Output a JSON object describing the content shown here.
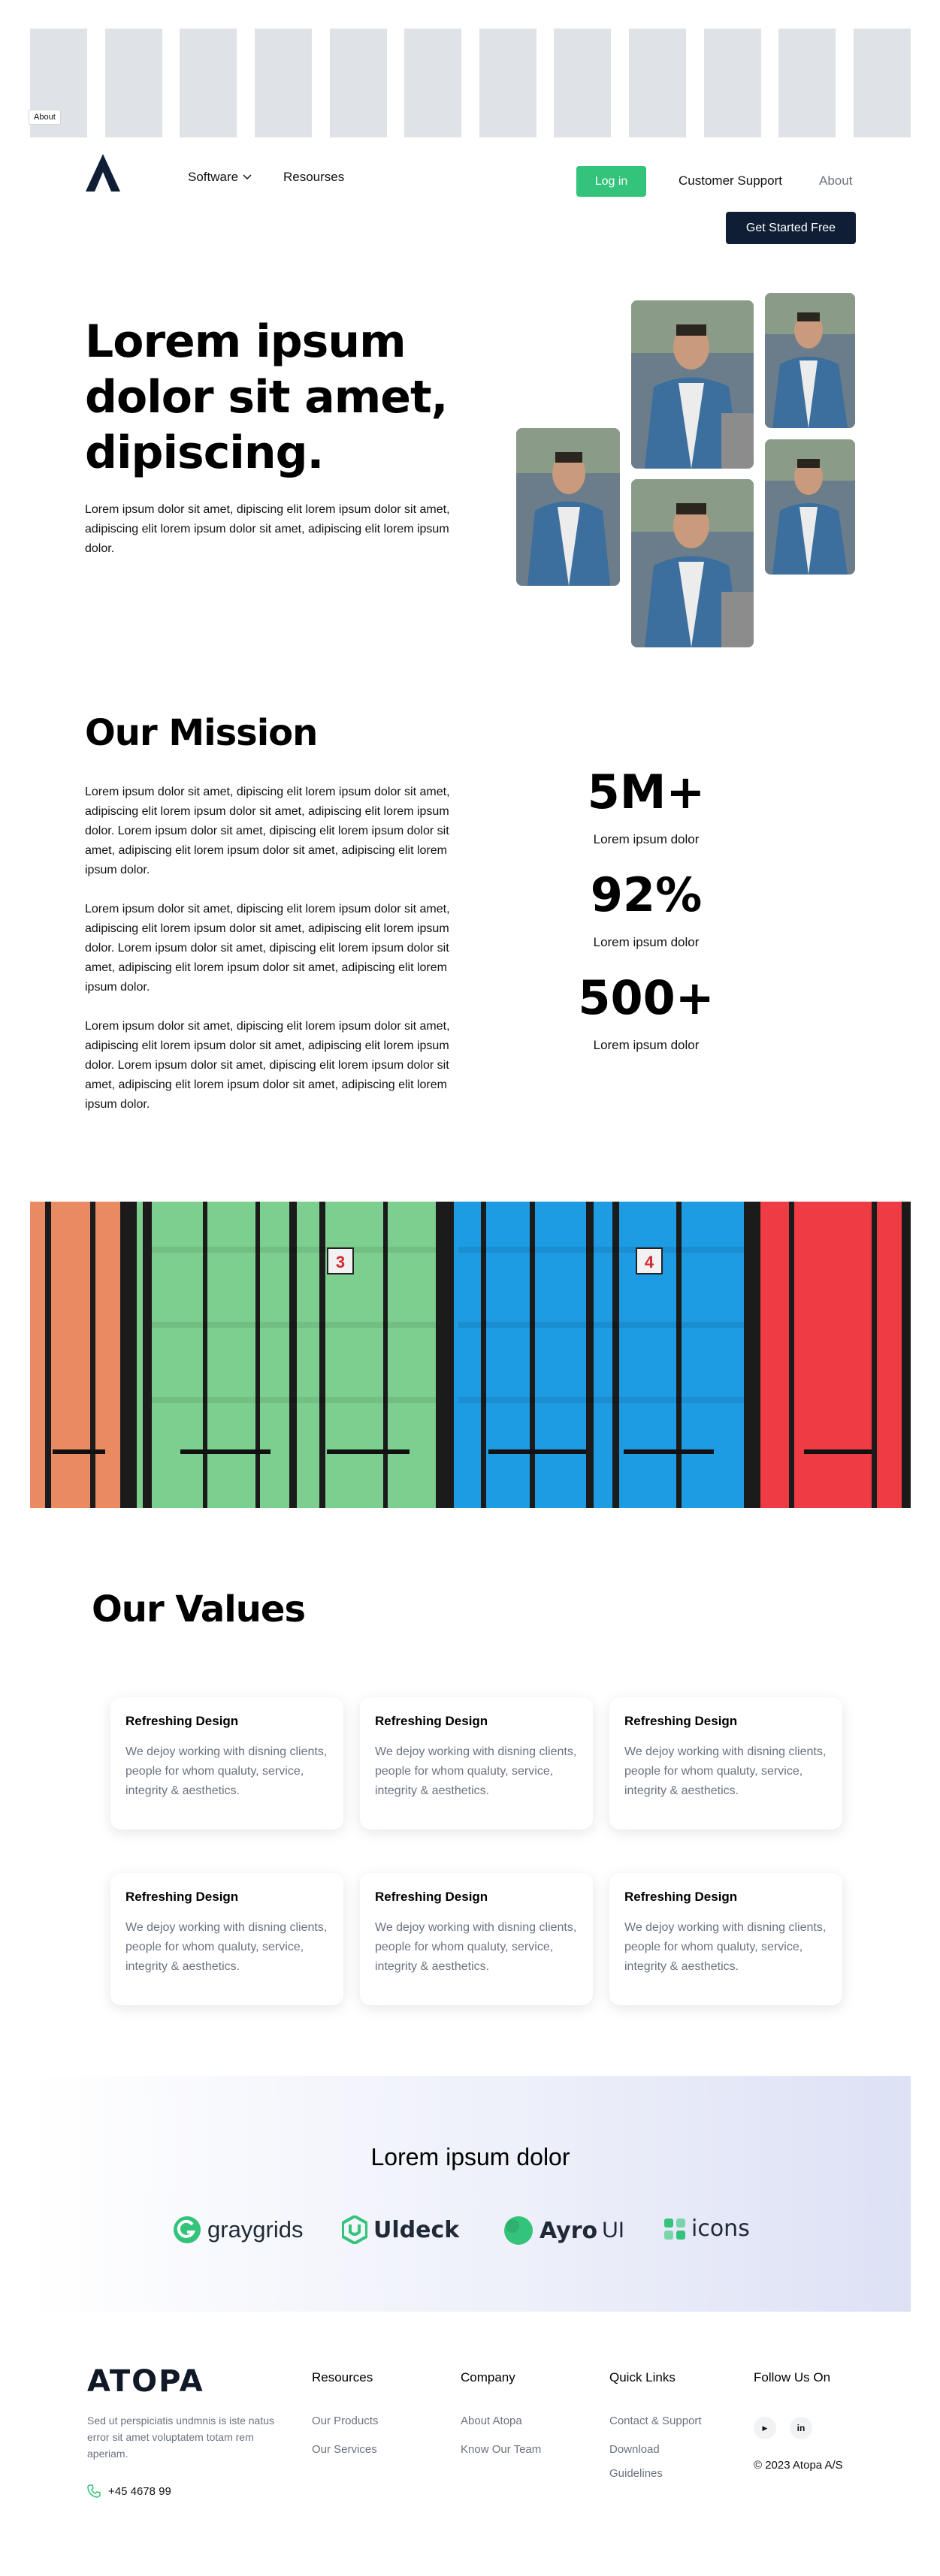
{
  "top_badge": "About",
  "nav": {
    "software": "Software",
    "resources": "Resourses",
    "login": "Log in",
    "support": "Customer Support",
    "about": "About",
    "get_started": "Get Started Free"
  },
  "hero": {
    "title": "Lorem ipsum dolor sit amet, dipiscing.",
    "text": "Lorem ipsum dolor sit amet, dipiscing elit lorem ipsum dolor sit amet, adipiscing elit lorem ipsum dolor sit amet, adipiscing elit lorem ipsum dolor."
  },
  "mission": {
    "title": "Our Mission",
    "paragraphs": [
      "Lorem ipsum dolor sit amet, dipiscing elit lorem ipsum dolor sit amet, adipiscing elit lorem ipsum dolor sit amet, adipiscing elit lorem ipsum dolor. Lorem ipsum dolor sit amet, dipiscing elit lorem ipsum dolor sit amet, adipiscing elit lorem ipsum dolor sit amet, adipiscing elit lorem ipsum dolor.",
      "Lorem ipsum dolor sit amet, dipiscing elit lorem ipsum dolor sit amet, adipiscing elit lorem ipsum dolor sit amet, adipiscing elit lorem ipsum dolor. Lorem ipsum dolor sit amet, dipiscing elit lorem ipsum dolor sit amet, adipiscing elit lorem ipsum dolor sit amet, adipiscing elit lorem ipsum dolor.",
      "Lorem ipsum dolor sit amet, dipiscing elit lorem ipsum dolor sit amet, adipiscing elit lorem ipsum dolor sit amet, adipiscing elit lorem ipsum dolor. Lorem ipsum dolor sit amet, dipiscing elit lorem ipsum dolor sit amet, adipiscing elit lorem ipsum dolor sit amet, adipiscing elit lorem ipsum dolor."
    ],
    "stats": [
      {
        "value": "5M+",
        "label": "Lorem ipsum dolor"
      },
      {
        "value": "92%",
        "label": "Lorem ipsum dolor"
      },
      {
        "value": "500+",
        "label": "Lorem ipsum dolor"
      }
    ]
  },
  "containers": {
    "label_a": "3",
    "label_b": "4"
  },
  "values": {
    "title": "Our Values",
    "cards": [
      {
        "title": "Refreshing Design",
        "desc": "We dejoy working with disning clients, people for whom qualuty, service, integrity & aesthetics."
      },
      {
        "title": "Refreshing Design",
        "desc": "We dejoy working with disning clients, people for whom qualuty, service, integrity & aesthetics."
      },
      {
        "title": "Refreshing Design",
        "desc": "We dejoy working with disning clients, people for whom qualuty, service, integrity & aesthetics."
      },
      {
        "title": "Refreshing Design",
        "desc": "We dejoy working with disning clients, people for whom qualuty, service, integrity & aesthetics."
      },
      {
        "title": "Refreshing Design",
        "desc": "We dejoy working with disning clients, people for whom qualuty, service, integrity & aesthetics."
      },
      {
        "title": "Refreshing Design",
        "desc": "We dejoy working with disning clients, people for whom qualuty, service, integrity & aesthetics."
      }
    ]
  },
  "brands": {
    "title": "Lorem ipsum dolor",
    "items": [
      {
        "name": "graygrids",
        "icon": "graygrids-logo"
      },
      {
        "name": "Uldeck",
        "icon": "uideck-logo"
      },
      {
        "name_bold": "Ayro",
        "name_light": "UI",
        "icon": "ayro-logo"
      },
      {
        "name": "icons",
        "icon": "lineicons-logo"
      }
    ],
    "accent": "#34c37a"
  },
  "footer": {
    "logo": "ATOPA",
    "desc": "Sed ut perspiciatis undmnis is iste natus error sit amet voluptatem totam rem aperiam.",
    "phone": "+45 4678 99",
    "columns": [
      {
        "title": "Resources",
        "links": [
          "Our Products",
          "Our Services"
        ]
      },
      {
        "title": "Company",
        "links": [
          "About Atopa",
          "Know Our Team"
        ]
      },
      {
        "title": "Quick Links",
        "links": [
          "Contact & Support",
          "Download",
          "Guidelines"
        ]
      }
    ],
    "follow_title": "Follow Us On",
    "social": [
      {
        "icon": "youtube-icon",
        "glyph": "▶"
      },
      {
        "icon": "linkedin-icon",
        "glyph": "in"
      }
    ],
    "copyright": "© 2023 Atopa A/S"
  },
  "colors": {
    "green": "#34c37a",
    "navy": "#0f1e35",
    "muted": "#6b7280"
  }
}
